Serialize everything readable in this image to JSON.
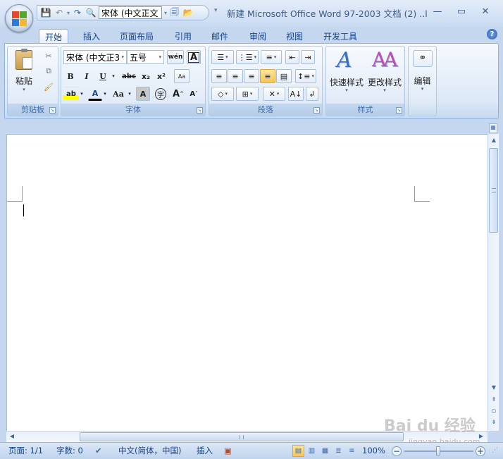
{
  "window": {
    "title": "新建 Microsoft Office Word 97-2003 文档 (2) ..l",
    "minimize": "—",
    "maximize": "▭",
    "close": "✕"
  },
  "qat": {
    "font_name": "宋体 (中文正文",
    "drop": "▾",
    "more": "▾"
  },
  "tabs": [
    "开始",
    "插入",
    "页面布局",
    "引用",
    "邮件",
    "审阅",
    "视图",
    "开发工具"
  ],
  "active_tab": "开始",
  "help_label": "?",
  "groups": {
    "clipboard": {
      "label": "剪贴板",
      "paste": "粘贴"
    },
    "font": {
      "label": "字体",
      "font_name": "宋体 (中文正3",
      "font_size": "五号",
      "bold": "B",
      "italic": "I",
      "underline": "U",
      "strike": "abc",
      "sub": "x₂",
      "sup": "x²",
      "aa": "Aa",
      "highlight": "ab",
      "fontcolor": "A",
      "charshade": "A",
      "enclose": "字",
      "grow": "A",
      "shrink": "A",
      "phonetic": "wén",
      "charborder": "A",
      "clear": "Aa"
    },
    "paragraph": {
      "label": "段落"
    },
    "styles": {
      "label": "样式",
      "quick": "快速样式",
      "change": "更改样式"
    },
    "editing": {
      "label": "编辑"
    }
  },
  "status": {
    "page": "页面: 1/1",
    "words": "字数: 0",
    "language": "中文(简体，中国)",
    "mode": "插入",
    "zoom": "100%",
    "minus": "−",
    "plus": "+"
  },
  "watermark": {
    "main": "Bai du 经验",
    "sub": "jingyan.baidu.com"
  }
}
